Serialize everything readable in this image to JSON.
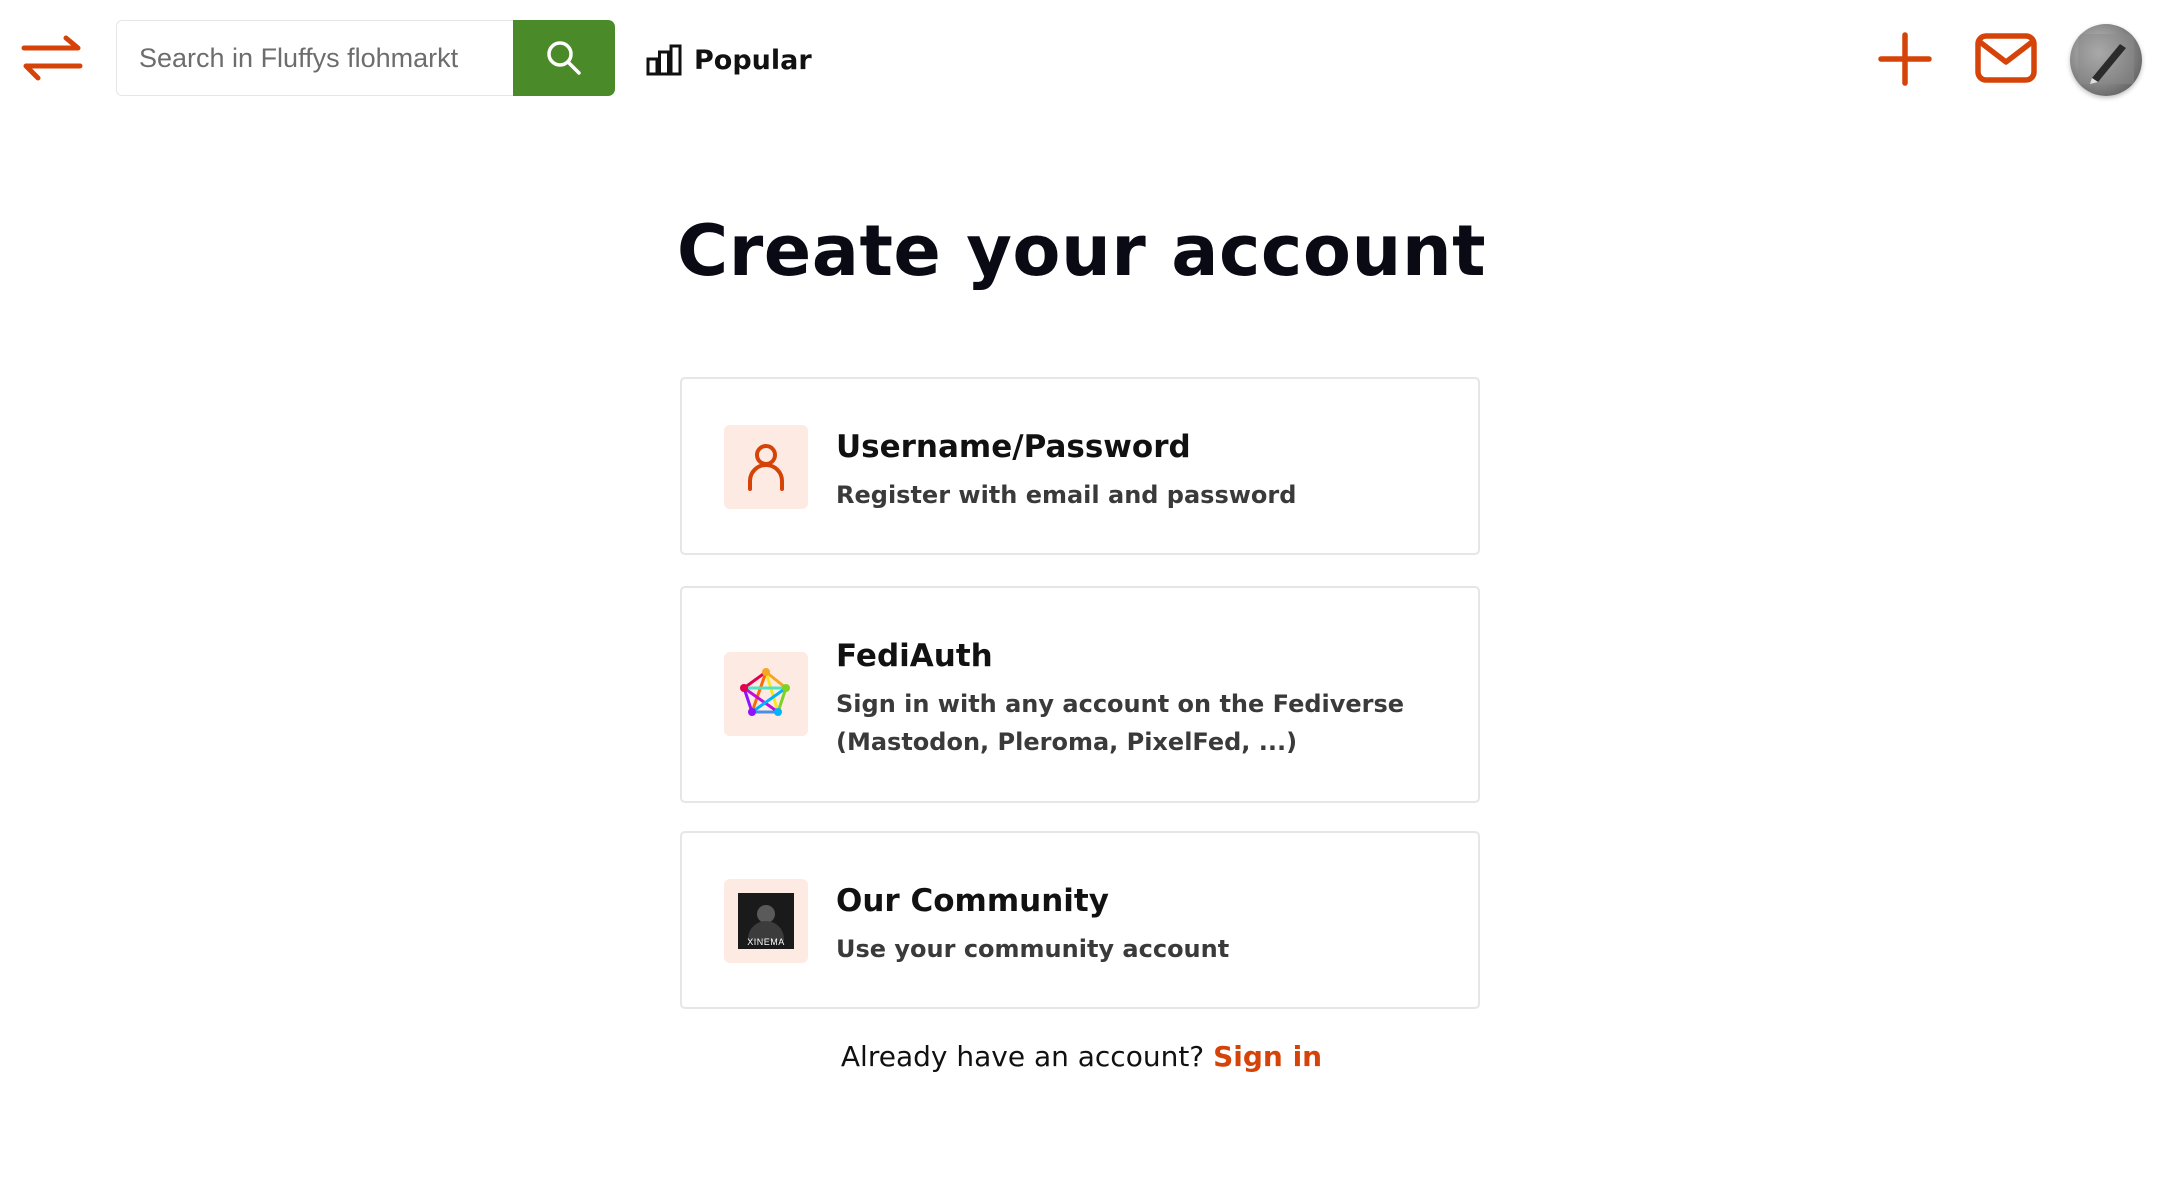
{
  "header": {
    "search": {
      "placeholder": "Search in Fluffys flohmarkt",
      "value": ""
    },
    "popular_label": "Popular",
    "icons": {
      "menu": "swap-arrows-icon",
      "search": "search-icon",
      "popular": "bar-chart-icon",
      "add": "plus-icon",
      "messages": "mail-icon",
      "avatar": "user-avatar"
    }
  },
  "main": {
    "title": "Create your account",
    "options": [
      {
        "title": "Username/Password",
        "description": "Register with email and password",
        "icon": "user-icon"
      },
      {
        "title": "FediAuth",
        "description_line1": "Sign in with any account on the Fediverse",
        "description_line2": "(Mastodon, Pleroma, PixelFed, ...)",
        "icon": "fediverse-icon"
      },
      {
        "title": "Our Community",
        "description": "Use your community account",
        "icon": "community-logo",
        "logo_text": "XINEMA"
      }
    ],
    "footer": {
      "prompt": "Already have an account?",
      "link": "Sign in"
    }
  },
  "colors": {
    "accent": "#d64309",
    "search_button": "#4a8a28",
    "icon_bg": "#fdebe3"
  }
}
